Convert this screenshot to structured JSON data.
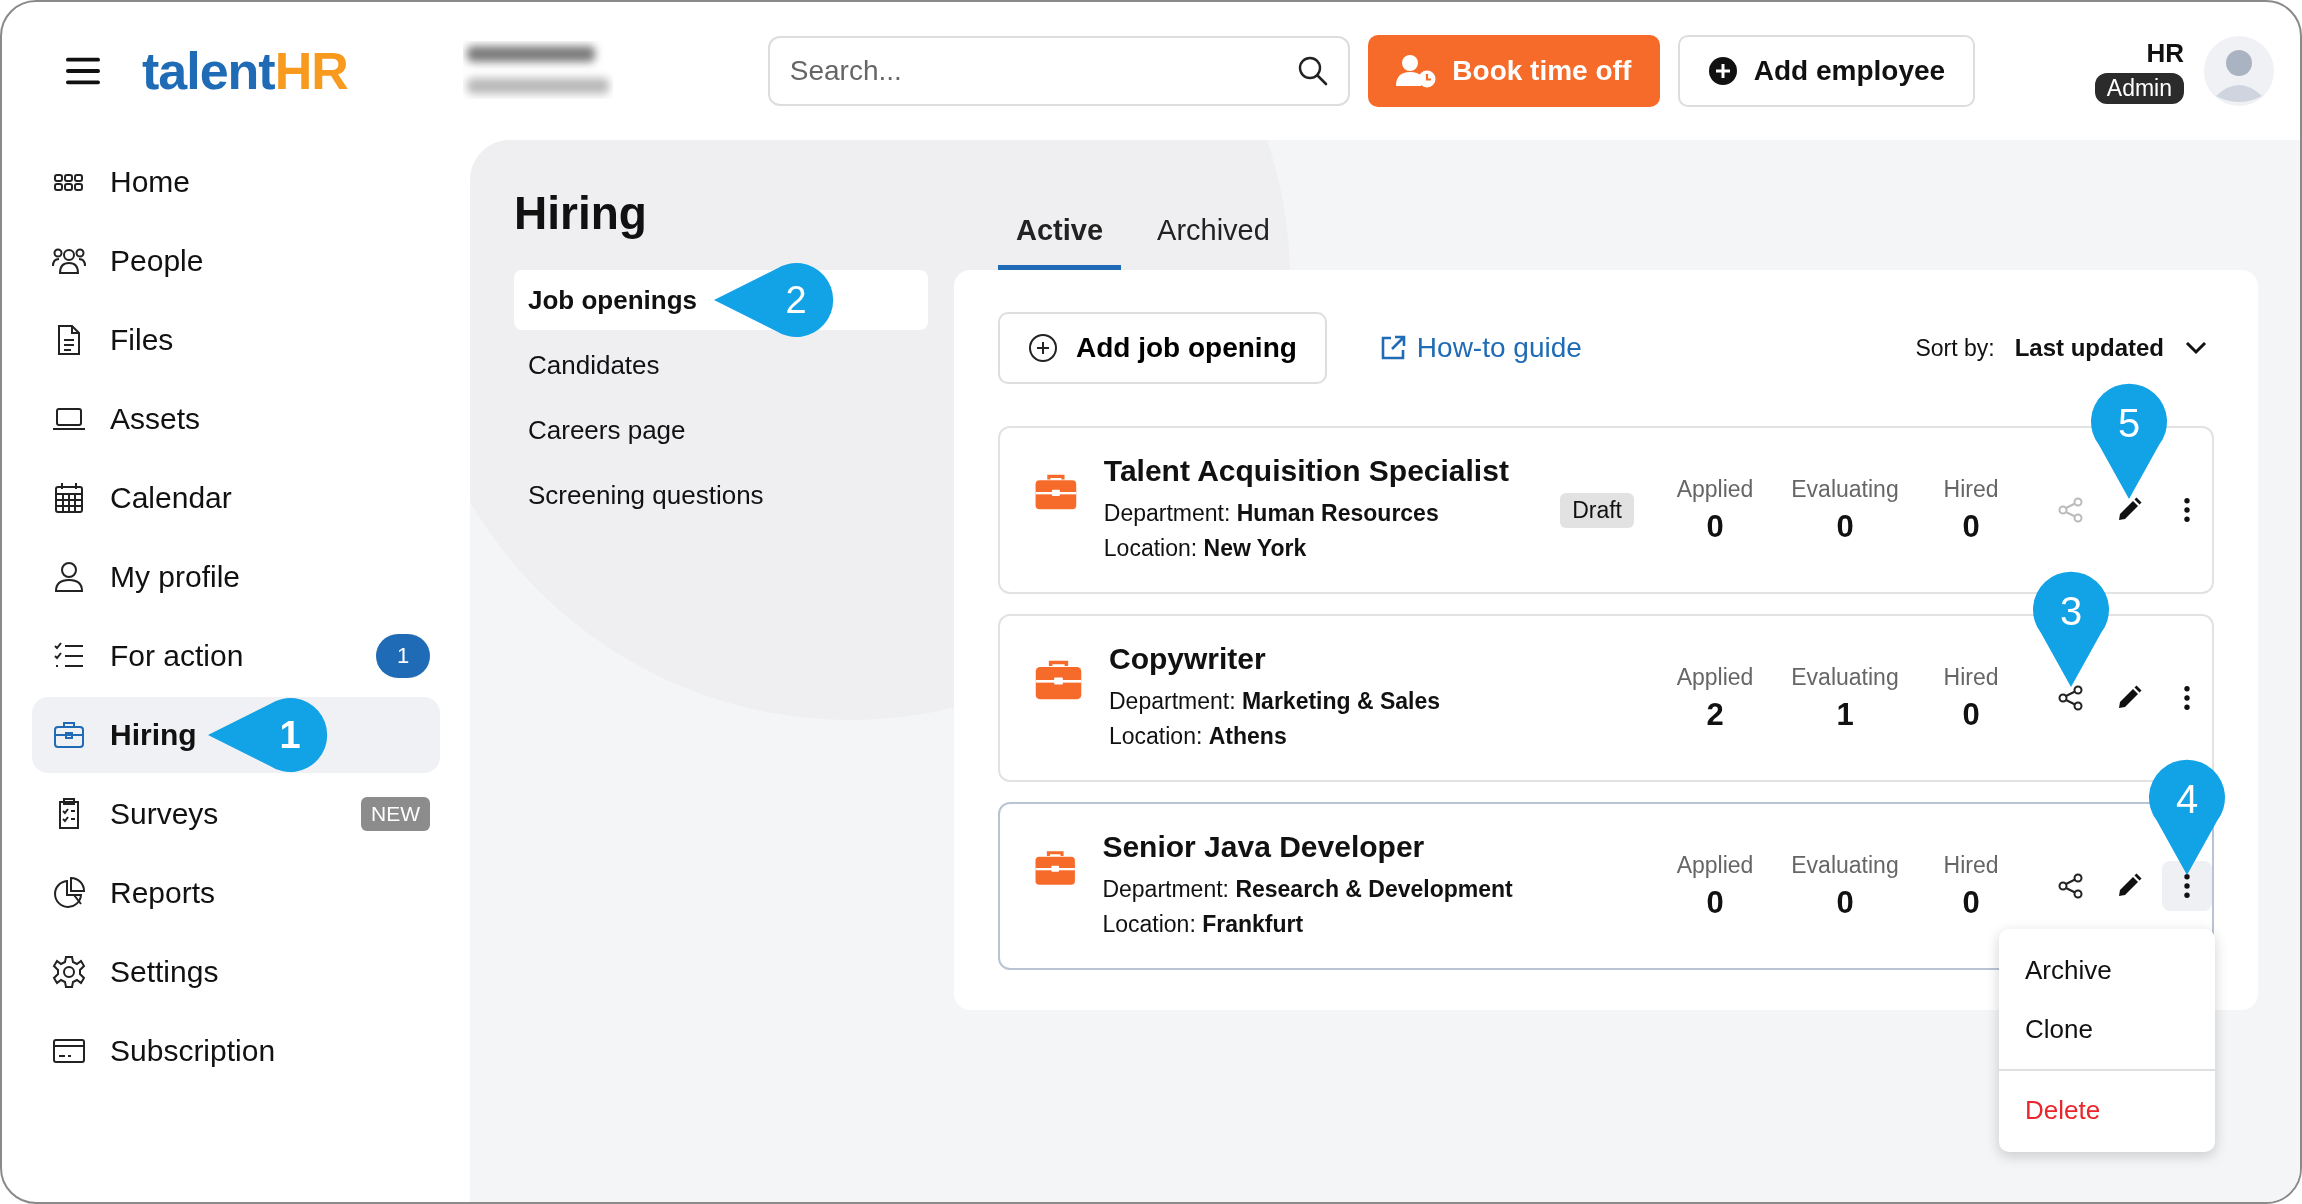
{
  "header": {
    "brand": {
      "first": "talent",
      "second": "HR"
    },
    "search": {
      "placeholder": "Search..."
    },
    "buttons": [
      {
        "label": "Book time off",
        "kind": "primary"
      },
      {
        "label": "Add employee",
        "kind": "secondary"
      }
    ],
    "user": {
      "name": "HR",
      "role": "Admin"
    }
  },
  "sidebar": {
    "items": [
      {
        "label": "Home",
        "selected": false
      },
      {
        "label": "People",
        "selected": false
      },
      {
        "label": "Files",
        "selected": false
      },
      {
        "label": "Assets",
        "selected": false
      },
      {
        "label": "Calendar",
        "selected": false
      },
      {
        "label": "My profile",
        "selected": false
      },
      {
        "label": "For action",
        "selected": false,
        "count": "1"
      },
      {
        "label": "Hiring",
        "selected": true,
        "callout": "1"
      },
      {
        "label": "Surveys",
        "selected": false,
        "tag": "NEW"
      },
      {
        "label": "Reports",
        "selected": false
      },
      {
        "label": "Settings",
        "selected": false
      },
      {
        "label": "Subscription",
        "selected": false
      }
    ]
  },
  "page": {
    "title": "Hiring",
    "subnav": [
      {
        "label": "Job openings",
        "selected": true,
        "callout": "2"
      },
      {
        "label": "Candidates",
        "selected": false
      },
      {
        "label": "Careers page",
        "selected": false
      },
      {
        "label": "Screening questions",
        "selected": false
      }
    ]
  },
  "tabs": [
    {
      "label": "Active",
      "selected": true
    },
    {
      "label": "Archived",
      "selected": false
    }
  ],
  "toolbar": {
    "add_button": "Add job opening",
    "guide_link": "How-to guide",
    "sort_label": "Sort by:",
    "sort_value": "Last updated"
  },
  "jobs": [
    {
      "title": "Talent Acquisition Specialist",
      "department_label": "Department:",
      "department": "Human Resources",
      "location_label": "Location:",
      "location": "New York",
      "status": "Draft",
      "share_disabled": true,
      "menu_open": false,
      "callouts": {
        "edit": "5"
      },
      "stats": [
        {
          "label": "Applied",
          "value": "0"
        },
        {
          "label": "Evaluating",
          "value": "0"
        },
        {
          "label": "Hired",
          "value": "0"
        }
      ]
    },
    {
      "title": "Copywriter",
      "department_label": "Department:",
      "department": "Marketing & Sales",
      "location_label": "Location:",
      "location": "Athens",
      "share_disabled": false,
      "menu_open": false,
      "callouts": {
        "share": "3"
      },
      "stats": [
        {
          "label": "Applied",
          "value": "2"
        },
        {
          "label": "Evaluating",
          "value": "1"
        },
        {
          "label": "Hired",
          "value": "0"
        }
      ]
    },
    {
      "title": "Senior Java Developer",
      "department_label": "Department:",
      "department": "Research & Development",
      "location_label": "Location:",
      "location": "Frankfurt",
      "share_disabled": false,
      "menu_open": true,
      "callouts": {
        "more": "4"
      },
      "stats": [
        {
          "label": "Applied",
          "value": "0"
        },
        {
          "label": "Evaluating",
          "value": "0"
        },
        {
          "label": "Hired",
          "value": "0"
        }
      ],
      "menu": [
        {
          "label": "Archive",
          "kind": "normal"
        },
        {
          "label": "Clone",
          "kind": "normal"
        },
        {
          "label": "Delete",
          "kind": "danger"
        }
      ]
    }
  ]
}
